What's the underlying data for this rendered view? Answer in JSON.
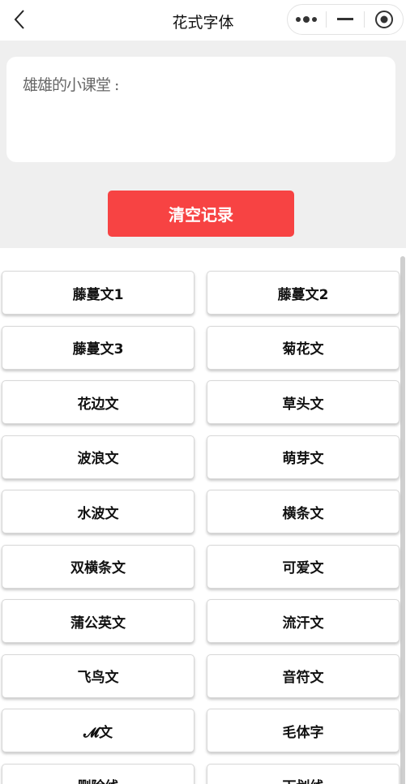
{
  "nav": {
    "title": "花式字体"
  },
  "editor": {
    "text": "雄雄的小课堂 :"
  },
  "clear_button": {
    "label": "清空记录"
  },
  "styles": [
    "藤蔓文1",
    "藤蔓文2",
    "藤蔓文3",
    "菊花文",
    "花边文",
    "草头文",
    "波浪文",
    "萌芽文",
    "水波文",
    "横条文",
    "双横条文",
    "可爱文",
    "蒲公英文",
    "流汗文",
    "飞鸟文",
    "音符文",
    "𝓜文",
    "毛体字",
    "删除线",
    "下划线"
  ],
  "colors": {
    "accent": "#f74343",
    "background": "#efefef"
  },
  "icons": [
    "chevron-left-icon",
    "more-dots-icon",
    "minimize-icon",
    "record-target-icon"
  ]
}
